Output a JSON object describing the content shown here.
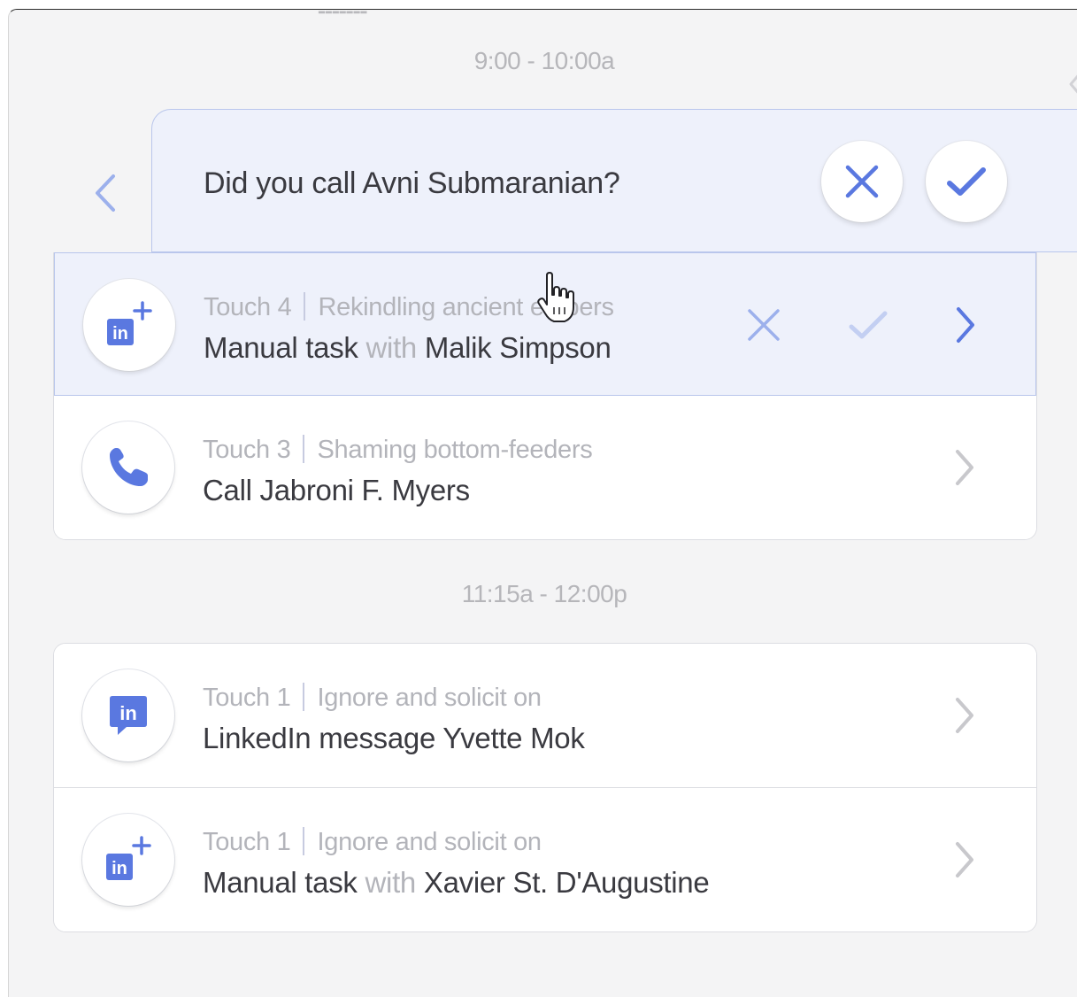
{
  "schedule": {
    "slots": [
      {
        "time_range": "9:00 - 10:00a",
        "prompt": {
          "question": "Did you call Avni Submaranian?",
          "icons": {
            "back": "chevron-left-icon",
            "dismiss": "x-icon",
            "confirm": "check-icon"
          }
        },
        "tasks": [
          {
            "touch": "Touch 4",
            "campaign": "Rekindling ancient embers",
            "action": "Manual task",
            "connector": "with",
            "contact": "Malik Simpson",
            "icon": "linkedin-add-icon",
            "active": true
          },
          {
            "touch": "Touch 3",
            "campaign": "Shaming bottom-feeders",
            "action": "Call Jabroni F. Myers",
            "icon": "phone-icon",
            "active": false
          }
        ]
      },
      {
        "time_range": "11:15a - 12:00p",
        "tasks": [
          {
            "touch": "Touch 1",
            "campaign": "Ignore and solicit on",
            "action": "LinkedIn message Yvette Mok",
            "icon": "linkedin-message-icon",
            "active": false
          },
          {
            "touch": "Touch 1",
            "campaign": "Ignore and solicit on",
            "action": "Manual task",
            "connector": "with",
            "contact": "Xavier St. D'Augustine",
            "icon": "linkedin-add-icon",
            "active": false
          }
        ]
      }
    ]
  },
  "colors": {
    "accent": "#5a78e0",
    "accent_light": "#b9c6ec",
    "active_bg": "#eef1fb",
    "muted_text": "#b3b4ba",
    "body_text": "#3a3a40",
    "chevron_gray": "#c8c8cc",
    "panel_bg": "#f4f4f5"
  }
}
